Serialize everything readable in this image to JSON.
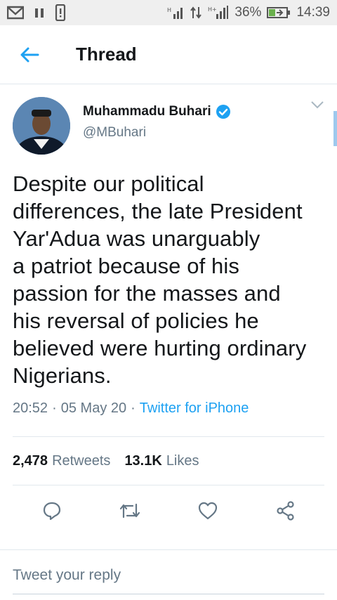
{
  "status_bar": {
    "battery": "36%",
    "time": "14:39",
    "network_h": "H"
  },
  "header": {
    "title": "Thread"
  },
  "tweet": {
    "author_name": "Muhammadu Buhari",
    "handle": "@MBuhari",
    "text_lines": [
      "Despite our political",
      "differences, the late President",
      "Yar'Adua was unarguably",
      "a patriot because of his",
      "passion for the masses and",
      "his reversal of policies he",
      "believed were hurting ordinary",
      "Nigerians."
    ],
    "time": "20:52",
    "date": "05 May 20",
    "separator": "·",
    "source": "Twitter for iPhone"
  },
  "stats": {
    "retweets_count": "2,478",
    "retweets_label": "Retweets",
    "likes_count": "13.1K",
    "likes_label": "Likes"
  },
  "reply": {
    "placeholder": "Tweet your reply"
  },
  "colors": {
    "accent": "#1da1f2",
    "secondary_text": "#657786",
    "primary_text": "#14171a"
  }
}
